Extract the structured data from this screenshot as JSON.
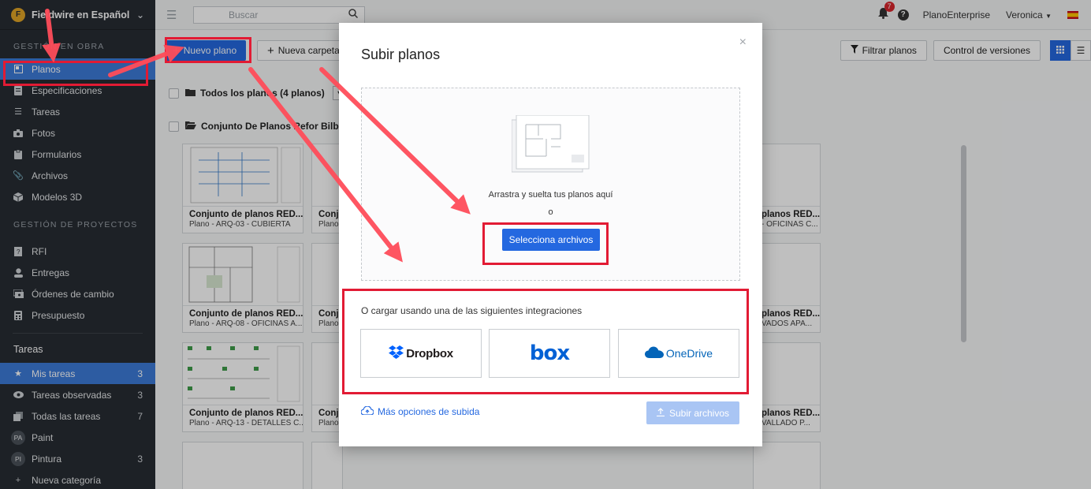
{
  "sidebar": {
    "workspace": "Fieldwire en Español",
    "logo_letter": "F",
    "section_obra": "GESTIÓN EN OBRA",
    "obra_items": [
      {
        "label": "Planos",
        "icon": "plans-icon"
      },
      {
        "label": "Especificaciones",
        "icon": "specs-icon"
      },
      {
        "label": "Tareas",
        "icon": "list-icon"
      },
      {
        "label": "Fotos",
        "icon": "camera-icon"
      },
      {
        "label": "Formularios",
        "icon": "clipboard-icon"
      },
      {
        "label": "Archivos",
        "icon": "paperclip-icon"
      },
      {
        "label": "Modelos 3D",
        "icon": "cube-icon"
      }
    ],
    "section_proyectos": "GESTIÓN DE PROYECTOS",
    "proyecto_items": [
      {
        "label": "RFI",
        "icon": "rfi-icon"
      },
      {
        "label": "Entregas",
        "icon": "person-icon"
      },
      {
        "label": "Órdenes de cambio",
        "icon": "money-icon"
      },
      {
        "label": "Presupuesto",
        "icon": "calculator-icon"
      }
    ],
    "tasks_title": "Tareas",
    "task_items": [
      {
        "label": "Mis tareas",
        "count": "3",
        "icon": "star-icon"
      },
      {
        "label": "Tareas observadas",
        "count": "3",
        "icon": "eye-icon"
      },
      {
        "label": "Todas las tareas",
        "count": "7",
        "icon": "stack-icon"
      },
      {
        "label": "Paint",
        "count": "",
        "avatar": "PA"
      },
      {
        "label": "Pintura",
        "count": "3",
        "avatar": "PI"
      },
      {
        "label": "Nueva categoría",
        "count": "",
        "icon": "plus-icon"
      }
    ]
  },
  "topbar": {
    "search_placeholder": "Buscar",
    "notifications": "7",
    "help": "?",
    "plan": "PlanoEnterprise",
    "user": "Veronica"
  },
  "toolbar": {
    "new_plan": "Nuevo plano",
    "new_folder": "Nueva carpeta",
    "filter": "Filtrar planos",
    "versions": "Control de versiones"
  },
  "list": {
    "all_plans": "Todos los planos (4 planos)",
    "set_name": "Conjunto De Planos Refor Bilbao"
  },
  "cards": [
    {
      "title": "Conjunto de planos RED...",
      "sub": "Plano - ARQ-03 - CUBIERTA"
    },
    {
      "title": "Conjunto de planos RED...",
      "sub": "Plano - ARQ-08 - OFICINAS A..."
    },
    {
      "title": "Conjunto de planos RED...",
      "sub": "Plano - ARQ-13 - DETALLES C..."
    },
    {
      "title": "Conju",
      "sub": "Plano"
    },
    {
      "title": "Conju",
      "sub": "Plano"
    },
    {
      "title": "Conju",
      "sub": "Plano"
    },
    {
      "title": "planos RED...",
      "sub": "- OFICINAS C..."
    },
    {
      "title": "planos RED...",
      "sub": "VADOS APA..."
    },
    {
      "title": "planos RED...",
      "sub": "VALLADO P..."
    }
  ],
  "modal": {
    "title": "Subir planos",
    "close": "×",
    "drag_text": "Arrastra y suelta tus planos aquí",
    "or": "o",
    "select": "Selecciona archivos",
    "integrations_label": "O cargar usando una de las siguientes integraciones",
    "integrations": [
      "Dropbox",
      "box",
      "OneDrive"
    ],
    "more_options": "Más opciones de subida",
    "upload": "Subir archivos"
  },
  "colors": {
    "primary": "#2468e0",
    "sidebar_bg": "#272c33",
    "active_item": "#3d7bd8",
    "annotation_red": "#e21b34",
    "dropbox": "#0061fe",
    "box": "#0061d5",
    "onedrive": "#0364b8"
  }
}
